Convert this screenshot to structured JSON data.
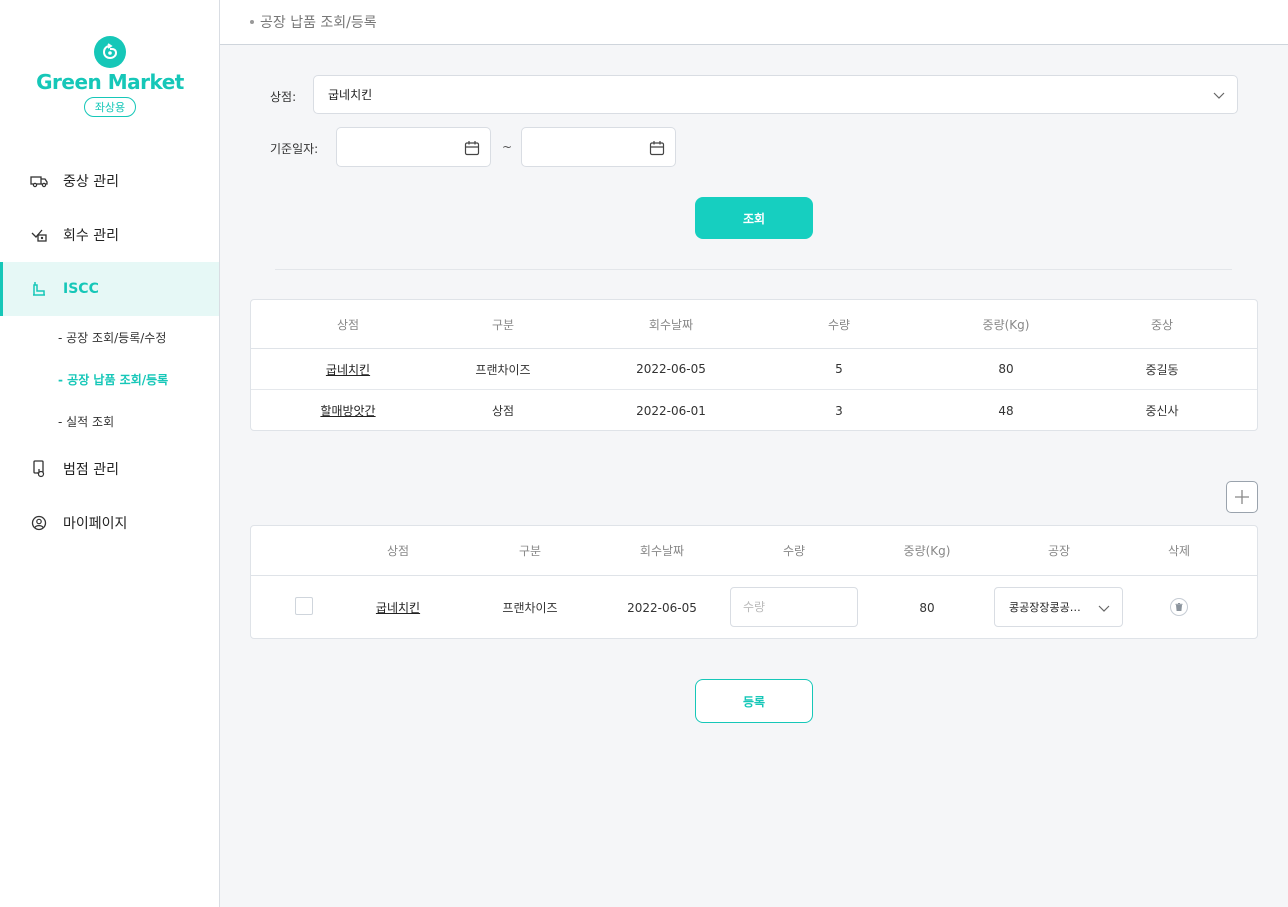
{
  "sidebar": {
    "brand": "Green Market",
    "badge": "좌상용",
    "items": [
      {
        "label": "중상 관리",
        "icon": "truck-icon"
      },
      {
        "label": "회수 관리",
        "icon": "collect-icon"
      },
      {
        "label": "ISCC",
        "icon": "factory-icon"
      },
      {
        "label": "범점 관리",
        "icon": "store-icon"
      },
      {
        "label": "마이페이지",
        "icon": "user-icon"
      }
    ],
    "subitems": [
      {
        "label": "- 공장 조회/등록/수정"
      },
      {
        "label": "- 공장 납품 조회/등록"
      },
      {
        "label": "- 실적 조회"
      }
    ]
  },
  "header": {
    "title": "공장 납품 조회/등록"
  },
  "filter": {
    "store_label": "상점:",
    "store_value": "굽네치킨",
    "date_label": "기준일자:",
    "tilde": "~",
    "search_button": "조회"
  },
  "table1": {
    "headers": [
      "상점",
      "구분",
      "회수날짜",
      "수량",
      "중량(Kg)",
      "중상"
    ],
    "rows": [
      [
        "굽네치킨",
        "프랜차이즈",
        "2022-06-05",
        "5",
        "80",
        "중길동"
      ],
      [
        "할매방앗간",
        "상점",
        "2022-06-01",
        "3",
        "48",
        "중신사"
      ]
    ]
  },
  "table2": {
    "headers": [
      "상점",
      "구분",
      "회수날짜",
      "수량",
      "중량(Kg)",
      "공장",
      "삭제"
    ],
    "row": {
      "store": "굽네치킨",
      "type": "프랜차이즈",
      "date": "2022-06-05",
      "qty_placeholder": "수량",
      "weight": "80",
      "factory": "콩공장장콩공…"
    }
  },
  "register_button": "등록",
  "colors": {
    "accent": "#16c7b8",
    "button": "#16cfc0"
  }
}
